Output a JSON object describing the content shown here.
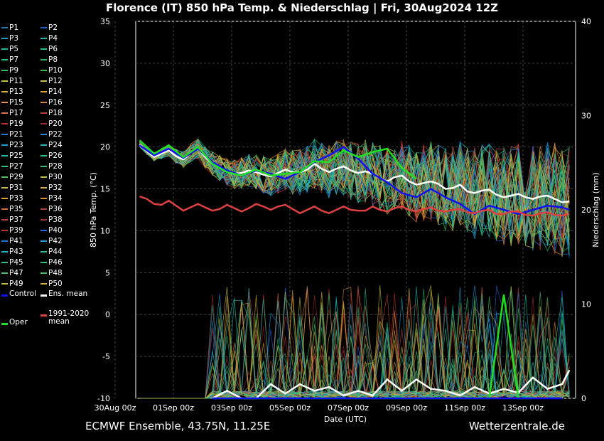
{
  "title": "Florence  (IT)  850 hPa Temp. & Niederschlag | Fri, 30Aug2024 12Z",
  "footer": {
    "left": "ECMWF Ensemble, 43.75N, 11.25E",
    "right": "Wetterzentrale.de"
  },
  "legend": {
    "members": [
      "P1",
      "P2",
      "P3",
      "P4",
      "P5",
      "P6",
      "P7",
      "P8",
      "P9",
      "P10",
      "P11",
      "P12",
      "P13",
      "P14",
      "P15",
      "P16",
      "P17",
      "P18",
      "P19",
      "P20",
      "P21",
      "P22",
      "P23",
      "P24",
      "P25",
      "P26",
      "P27",
      "P28",
      "P29",
      "P30",
      "P31",
      "P32",
      "P33",
      "P34",
      "P35",
      "P36",
      "P37",
      "P38",
      "P39",
      "P40",
      "P41",
      "P42",
      "P43",
      "P44",
      "P45",
      "P46",
      "P47",
      "P48",
      "P49",
      "P50"
    ],
    "member_colors": [
      "#1f77b4",
      "#1f5fd4",
      "#1fa0c4",
      "#1fb0b0",
      "#20b8a0",
      "#20c090",
      "#20c480",
      "#20b870",
      "#30c060",
      "#30c040",
      "#c8c040",
      "#d0c040",
      "#d8b040",
      "#e0a030",
      "#e09040",
      "#d08040",
      "#e07050",
      "#c04030",
      "#c03030",
      "#a02020",
      "#1f7ad4",
      "#1f8ae4",
      "#1fa0d4",
      "#1fb8c4",
      "#20c0a8",
      "#20c498",
      "#30c080",
      "#30c070",
      "#50c060",
      "#c0c040",
      "#d0c040",
      "#e0b030",
      "#e0a030",
      "#e09030",
      "#d07040",
      "#b04030",
      "#c04040",
      "#a03030",
      "#c83030",
      "#1f6ae4",
      "#1f7ad4",
      "#1f9ae4",
      "#20b8c8",
      "#20c0a0",
      "#30c090",
      "#30c080",
      "#50c070",
      "#40c060",
      "#c0c040",
      "#d8b030"
    ],
    "control": "Control",
    "ens_mean": "Ens. mean",
    "clim_mean": "1991-2020 mean",
    "oper": "Oper",
    "control_color": "#1010f0",
    "ens_mean_color": "#ffffff",
    "clim_color": "#e04040",
    "oper_color": "#20e020"
  },
  "chart_data": {
    "type": "line",
    "xlabel": "Date (UTC)",
    "ylabel": "850 hPa Temp. (°C)",
    "y2label": "Niederschlag (mm)",
    "x_ticks": [
      "30Aug 00z",
      "01Sep 00z",
      "03Sep 00z",
      "05Sep 00z",
      "07Sep 00z",
      "09Sep 00z",
      "11Sep 00z",
      "13Sep 00z"
    ],
    "ylim": [
      -10,
      35
    ],
    "y_ticks": [
      -10,
      -5,
      0,
      5,
      10,
      15,
      20,
      25,
      30,
      35
    ],
    "y2lim": [
      0,
      40
    ],
    "y2_ticks": [
      0,
      10,
      20,
      30,
      40
    ],
    "xlim_days": [
      0,
      16.25
    ],
    "grid": true,
    "series": [
      {
        "name": "Ens. mean",
        "x": [
          1.5,
          1.75,
          2,
          2.25,
          2.5,
          2.75,
          3,
          3.25,
          3.5,
          3.75,
          4,
          4.25,
          4.5,
          4.75,
          5,
          5.25,
          5.5,
          5.75,
          6,
          6.25,
          6.5,
          6.75,
          7,
          7.25,
          7.5,
          7.75,
          8,
          8.25,
          8.5,
          8.75,
          9,
          9.25,
          9.5,
          9.75,
          10,
          10.25,
          10.5,
          10.75,
          11,
          11.25,
          11.5,
          11.75,
          12,
          12.25,
          12.5,
          12.75,
          13,
          13.25,
          13.5,
          13.75,
          14,
          14.25,
          14.5,
          14.75,
          15,
          15.25,
          15.5,
          15.75,
          16,
          16.25
        ],
        "y": [
          20.3,
          19.5,
          18.8,
          19.2,
          19.6,
          18.9,
          18.5,
          19.3,
          19.8,
          18.8,
          18.0,
          17.5,
          17.0,
          16.8,
          16.9,
          17.2,
          17.0,
          16.7,
          16.5,
          16.9,
          17.3,
          17.0,
          17.0,
          17.3,
          18.0,
          17.4,
          17.0,
          17.4,
          17.7,
          17.2,
          16.9,
          17.1,
          16.8,
          16.3,
          15.9,
          16.4,
          16.6,
          15.9,
          15.5,
          15.7,
          15.9,
          15.6,
          15.0,
          15.1,
          15.5,
          14.7,
          14.5,
          14.8,
          14.9,
          14.3,
          14.0,
          14.2,
          14.4,
          14.0,
          13.8,
          14.1,
          14.2,
          13.8,
          13.4,
          13.5
        ]
      },
      {
        "name": "Control",
        "x": [
          1.5,
          2,
          2.5,
          3,
          3.5,
          4,
          4.5,
          5,
          5.5,
          6,
          6.5,
          7,
          7.5,
          8,
          8.5,
          9,
          9.5,
          10,
          10.5,
          11,
          11.5,
          12,
          12.5,
          13,
          13.5,
          14,
          14.5,
          15,
          15.5,
          16,
          16.25
        ],
        "y": [
          20.2,
          19.0,
          19.8,
          18.7,
          19.8,
          18.2,
          17.2,
          16.6,
          17.2,
          16.8,
          16.2,
          17.0,
          18.2,
          19.0,
          20.0,
          18.6,
          16.8,
          15.8,
          14.5,
          14.0,
          15.0,
          14.0,
          13.2,
          12.0,
          13.0,
          12.5,
          12.0,
          12.5,
          13.0,
          12.8,
          12.5
        ]
      },
      {
        "name": "Oper",
        "x": [
          1.5,
          2,
          2.5,
          3,
          3.5,
          4,
          4.5,
          5,
          5.5,
          6,
          6.5,
          7,
          7.5,
          8,
          8.5,
          9,
          9.5,
          10,
          10.5,
          11
        ],
        "y": [
          20.8,
          19.2,
          20.2,
          18.8,
          20.0,
          18.0,
          17.0,
          16.6,
          17.3,
          16.6,
          16.8,
          17.0,
          18.3,
          18.2,
          19.6,
          18.8,
          19.4,
          19.8,
          17.5,
          16.2
        ]
      },
      {
        "name": "1991-2020 mean",
        "x": [
          1.5,
          1.75,
          2,
          2.25,
          2.5,
          2.75,
          3,
          3.25,
          3.5,
          3.75,
          4,
          4.25,
          4.5,
          4.75,
          5,
          5.25,
          5.5,
          5.75,
          6,
          6.25,
          6.5,
          6.75,
          7,
          7.25,
          7.5,
          7.75,
          8,
          8.25,
          8.5,
          8.75,
          9,
          9.25,
          9.5,
          9.75,
          10,
          10.25,
          10.5,
          10.75,
          11,
          11.25,
          11.5,
          11.75,
          12,
          12.25,
          12.5,
          12.75,
          13,
          13.25,
          13.5,
          13.75,
          14,
          14.25,
          14.5,
          14.75,
          15,
          15.25,
          15.5,
          15.75,
          16,
          16.25
        ],
        "y": [
          14.1,
          13.8,
          13.2,
          13.1,
          13.6,
          13.0,
          12.4,
          12.8,
          13.2,
          12.8,
          12.4,
          12.6,
          13.1,
          12.7,
          12.3,
          12.7,
          13.2,
          12.9,
          12.5,
          12.9,
          13.1,
          12.6,
          12.1,
          12.5,
          12.9,
          12.4,
          12.1,
          12.5,
          12.9,
          12.5,
          12.4,
          12.4,
          12.9,
          12.5,
          12.3,
          12.7,
          12.9,
          12.5,
          12.3,
          12.6,
          12.8,
          12.4,
          12.3,
          12.5,
          12.6,
          12.2,
          12.1,
          12.4,
          12.5,
          12.0,
          12.0,
          12.3,
          12.3,
          11.9,
          11.8,
          12.1,
          12.2,
          11.9,
          11.8,
          12.0
        ]
      },
      {
        "name": "Ens. mean precip",
        "axis": "y2",
        "x": [
          4,
          4.5,
          5,
          5.5,
          6,
          6.5,
          7,
          7.5,
          8,
          8.5,
          9,
          9.5,
          10,
          10.5,
          11,
          11.5,
          12,
          12.5,
          13,
          13.5,
          14,
          14.5,
          15,
          15.5,
          16,
          16.25
        ],
        "y": [
          0,
          0.8,
          0,
          0,
          1.5,
          0.5,
          1.5,
          0.8,
          1.2,
          0.3,
          0.8,
          0.3,
          2.0,
          0.8,
          2.0,
          1.0,
          0.8,
          0.3,
          1.2,
          0.5,
          1.0,
          0.6,
          2.2,
          1.0,
          1.5,
          3.0
        ]
      },
      {
        "name": "Oper precip",
        "axis": "y2",
        "x": [
          4,
          4.5,
          5,
          5.5,
          6,
          6.5,
          7,
          7.5,
          8,
          8.5,
          9,
          9.5,
          10,
          10.5,
          11,
          11.5,
          12,
          12.5,
          13,
          13.5,
          14,
          14.5,
          15
        ],
        "y": [
          0,
          0,
          0,
          0,
          0,
          0,
          0,
          0,
          0,
          0,
          0,
          0,
          0,
          0,
          0,
          0,
          0,
          0,
          0,
          0,
          11.0,
          0,
          0
        ]
      },
      {
        "name": "Control precip",
        "axis": "y2",
        "x": [
          4,
          4.5,
          5,
          5.5,
          6,
          6.5,
          7,
          7.5,
          8,
          8.5,
          9,
          9.5,
          10,
          10.5,
          11,
          11.5,
          12,
          12.5,
          13,
          13.5,
          14,
          14.5,
          15,
          15.5,
          16
        ],
        "y": [
          0,
          0,
          0,
          0,
          0,
          0,
          0,
          0,
          0,
          0,
          0,
          0,
          0,
          0,
          0,
          0,
          0,
          0,
          0,
          0,
          0,
          0,
          0,
          0,
          0
        ]
      }
    ]
  }
}
